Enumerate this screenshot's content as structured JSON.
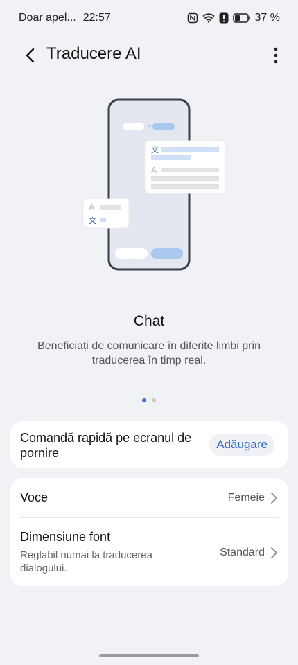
{
  "status_bar": {
    "carrier": "Doar apel...",
    "time": "22:57",
    "battery": "37 %",
    "icons": [
      "nfc-icon",
      "wifi-icon",
      "alert-icon",
      "battery-icon"
    ]
  },
  "app_bar": {
    "title": "Traducere AI",
    "back_icon": "back-arrow-icon",
    "more_icon": "more-vertical-icon"
  },
  "illustration": {
    "glyph_translate": "文",
    "glyph_latin": "A"
  },
  "feature": {
    "title": "Chat",
    "description": "Beneficiați de comunicare în diferite limbi prin traducerea în timp real."
  },
  "pager": {
    "pages": 2,
    "current": 1
  },
  "shortcut_card": {
    "label": "Comandă rapidă pe ecranul de pornire",
    "button": "Adăugare"
  },
  "settings": [
    {
      "title": "Voce",
      "value": "Femeie"
    },
    {
      "title": "Dimensiune font",
      "subtitle": "Reglabil numai la traducerea dialogului.",
      "value": "Standard"
    }
  ],
  "colors": {
    "accent": "#2a66cc",
    "background": "#f1f2f6",
    "card": "#ffffff"
  }
}
